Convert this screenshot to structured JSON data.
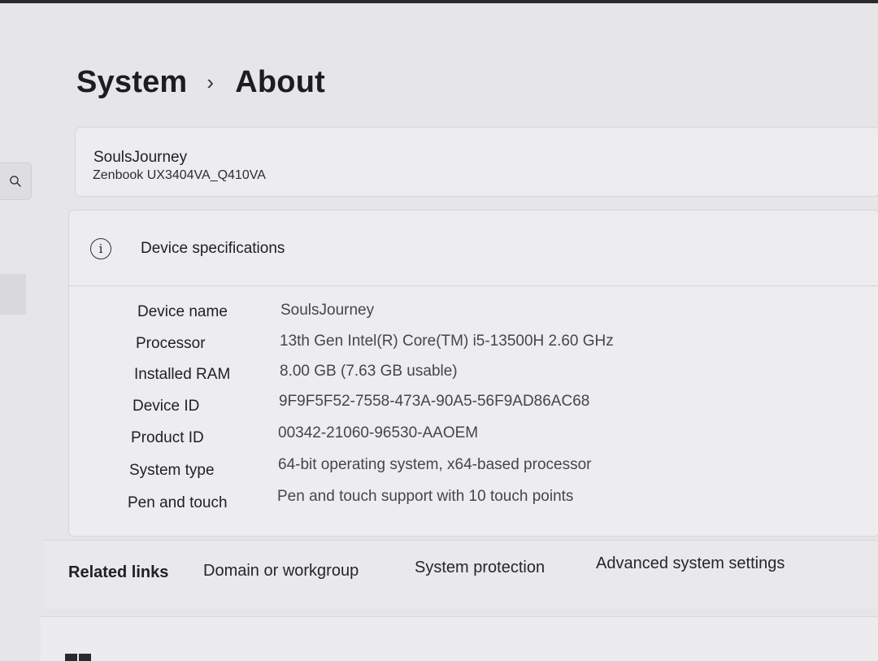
{
  "breadcrumb": {
    "parent": "System",
    "separator": "›",
    "current": "About"
  },
  "device": {
    "name": "SoulsJourney",
    "model": "Zenbook UX3404VA_Q410VA"
  },
  "specifications": {
    "title": "Device specifications",
    "icon": "info-icon",
    "rows": [
      {
        "label": "Device name",
        "value": "SoulsJourney"
      },
      {
        "label": "Processor",
        "value": "13th Gen Intel(R) Core(TM) i5-13500H   2.60 GHz"
      },
      {
        "label": "Installed RAM",
        "value": "8.00 GB (7.63 GB usable)"
      },
      {
        "label": "Device ID",
        "value": "9F9F5F52-7558-473A-90A5-56F9AD86AC68"
      },
      {
        "label": "Product ID",
        "value": "00342-21060-96530-AAOEM"
      },
      {
        "label": "System type",
        "value": "64-bit operating system, x64-based processor"
      },
      {
        "label": "Pen and touch",
        "value": "Pen and touch support with 10 touch points"
      }
    ]
  },
  "related_links": {
    "label": "Related links",
    "links": [
      "Domain or workgroup",
      "System protection",
      "Advanced system settings"
    ]
  },
  "sidebar": {
    "search_icon": "search-icon"
  }
}
